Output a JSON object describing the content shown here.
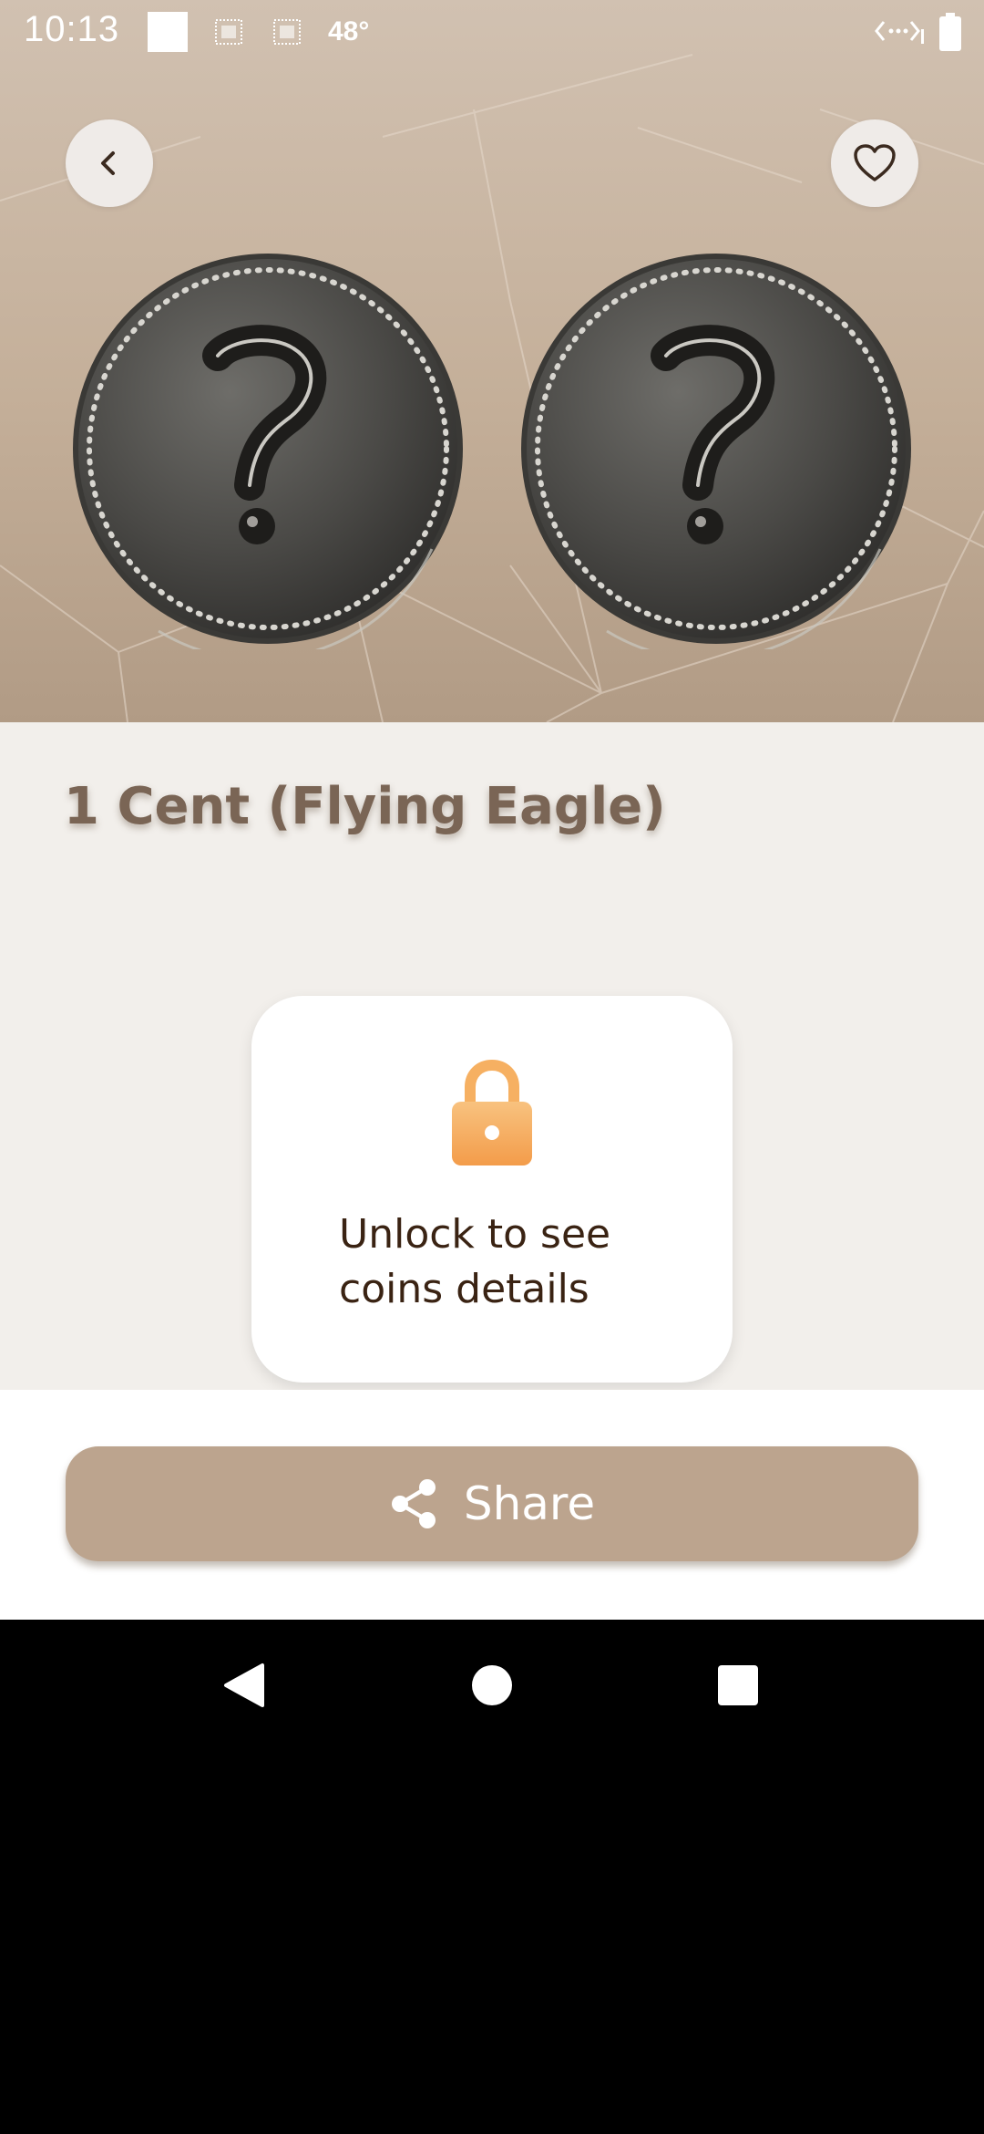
{
  "status_bar": {
    "time": "10:13",
    "temperature": "48°",
    "icons": [
      "notification-square-icon",
      "app-notification-icon",
      "app-notification-icon",
      "wifi-calling-icon",
      "battery-icon"
    ]
  },
  "header": {
    "back_icon": "chevron-left-icon",
    "favorite_icon": "heart-outline-icon"
  },
  "coin": {
    "title": "1 Cent (Flying Eagle)",
    "obverse_image": "unknown-coin-question-mark",
    "reverse_image": "unknown-coin-question-mark"
  },
  "lock_card": {
    "icon": "lock-icon",
    "line1": "Unlock to see",
    "line2": "coins details"
  },
  "share": {
    "icon": "share-icon",
    "label": "Share"
  },
  "system_nav": {
    "back": "back-triangle-icon",
    "home": "home-circle-icon",
    "recents": "recents-square-icon"
  },
  "colors": {
    "hero_top": "#d1c1b1",
    "hero_bottom": "#b19b85",
    "content_bg": "#f2efeb",
    "title": "#7a6555",
    "share_button": "#bca48e",
    "lock_orange": "#f4a85a"
  }
}
